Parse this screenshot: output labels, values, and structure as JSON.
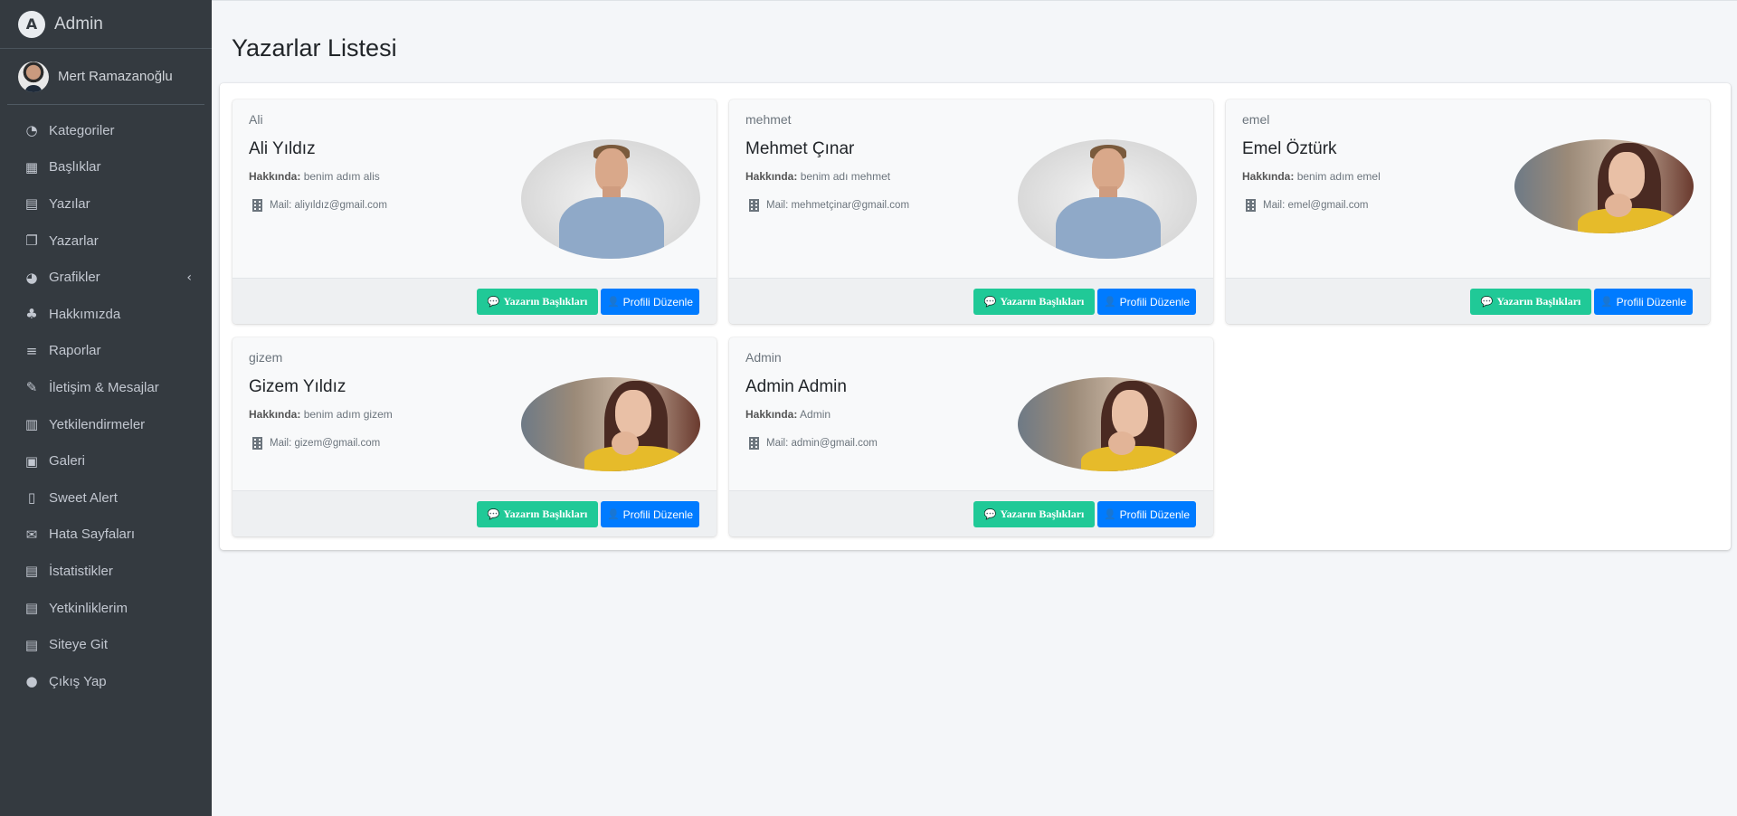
{
  "brand": {
    "title": "Admin",
    "logo_letter": "A"
  },
  "user": {
    "name": "Mert Ramazanoğlu"
  },
  "sidebar": {
    "items": [
      {
        "label": "Kategoriler",
        "icon": "tachometer-icon",
        "glyph": "◔"
      },
      {
        "label": "Başlıklar",
        "icon": "grid-icon",
        "glyph": "▦"
      },
      {
        "label": "Yazılar",
        "icon": "book-icon",
        "glyph": "▤"
      },
      {
        "label": "Yazarlar",
        "icon": "copy-icon",
        "glyph": "❐"
      },
      {
        "label": "Grafikler",
        "icon": "pie-chart-icon",
        "glyph": "◕",
        "chevron": "‹"
      },
      {
        "label": "Hakkımızda",
        "icon": "tree-icon",
        "glyph": "♣"
      },
      {
        "label": "Raporlar",
        "icon": "list-icon",
        "glyph": "≡"
      },
      {
        "label": "İletişim & Mesajlar",
        "icon": "edit-icon",
        "glyph": "✎"
      },
      {
        "label": "Yetkilendirmeler",
        "icon": "calendar-icon",
        "glyph": "▥"
      },
      {
        "label": "Galeri",
        "icon": "image-icon",
        "glyph": "▣"
      },
      {
        "label": "Sweet Alert",
        "icon": "map-icon",
        "glyph": "▯"
      },
      {
        "label": "Hata Sayfaları",
        "icon": "envelope-icon",
        "glyph": "✉"
      },
      {
        "label": "İstatistikler",
        "icon": "book-icon",
        "glyph": "▤"
      },
      {
        "label": "Yetkinliklerim",
        "icon": "book-icon",
        "glyph": "▤"
      },
      {
        "label": "Siteye Git",
        "icon": "book-icon",
        "glyph": "▤"
      },
      {
        "label": "Çıkış Yap",
        "icon": "apple-icon",
        "glyph": "●"
      }
    ]
  },
  "page": {
    "title": "Yazarlar Listesi"
  },
  "cards": [
    {
      "username": "Ali",
      "fullname": "Ali Yıldız",
      "about_label": "Hakkında:",
      "about": "benim adım alis",
      "mail": "Mail: aliyıldız@gmail.com",
      "photo": "man",
      "btn_titles": "Yazarın Başlıkları",
      "btn_profile": "Profili Düzenle"
    },
    {
      "username": "mehmet",
      "fullname": "Mehmet Çınar",
      "about_label": "Hakkında:",
      "about": "benim adı mehmet",
      "mail": "Mail: mehmetçinar@gmail.com",
      "photo": "man",
      "btn_titles": "Yazarın Başlıkları",
      "btn_profile": "Profili Düzenle"
    },
    {
      "username": "emel",
      "fullname": "Emel Öztürk",
      "about_label": "Hakkında:",
      "about": "benim adım emel",
      "mail": "Mail: emel@gmail.com",
      "photo": "woman",
      "btn_titles": "Yazarın Başlıkları",
      "btn_profile": "Profili Düzenle"
    },
    {
      "username": "gizem",
      "fullname": "Gizem Yıldız",
      "about_label": "Hakkında:",
      "about": "benim adım gizem",
      "mail": "Mail: gizem@gmail.com",
      "photo": "woman",
      "btn_titles": "Yazarın Başlıkları",
      "btn_profile": "Profili Düzenle"
    },
    {
      "username": "Admin",
      "fullname": "Admin Admin",
      "about_label": "Hakkında:",
      "about": "Admin",
      "mail": "Mail: admin@gmail.com",
      "photo": "woman",
      "btn_titles": "Yazarın Başlıkları",
      "btn_profile": "Profili Düzenle"
    }
  ],
  "colors": {
    "sidebar_bg": "#343a40",
    "teal": "#20c997",
    "blue": "#007bff",
    "page_bg": "#f4f6f9"
  }
}
